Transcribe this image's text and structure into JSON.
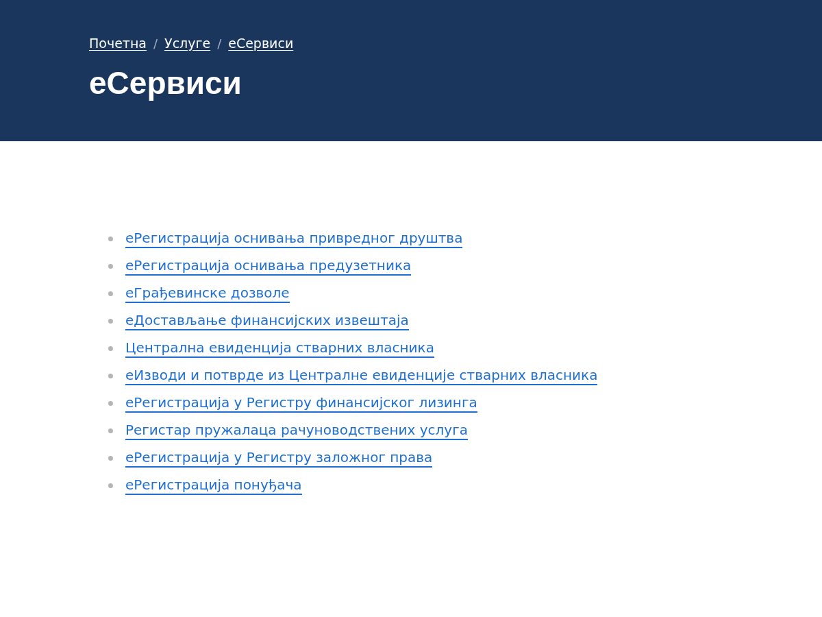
{
  "breadcrumb": {
    "separator": "/",
    "items": [
      {
        "label": "Почетна"
      },
      {
        "label": "Услуге"
      },
      {
        "label": "еСервиси"
      }
    ]
  },
  "title": "еСервиси",
  "services": [
    {
      "label": "еРегистрација оснивања привредног друштва"
    },
    {
      "label": "еРегистрација оснивања предузетника"
    },
    {
      "label": "еГрађевинске дозволе"
    },
    {
      "label": "еДостављање финансијских извештаја"
    },
    {
      "label": "Централна евиденција стварних власника"
    },
    {
      "label": "еИзводи и потврде из Централне евиденције стварних власника"
    },
    {
      "label": "еРегистрација у Регистру финансијског лизинга"
    },
    {
      "label": "Регистар пружалаца рачуноводствених услуга"
    },
    {
      "label": "еРегистрација у Регистру заложног права"
    },
    {
      "label": "еРегистрација понуђача"
    }
  ]
}
